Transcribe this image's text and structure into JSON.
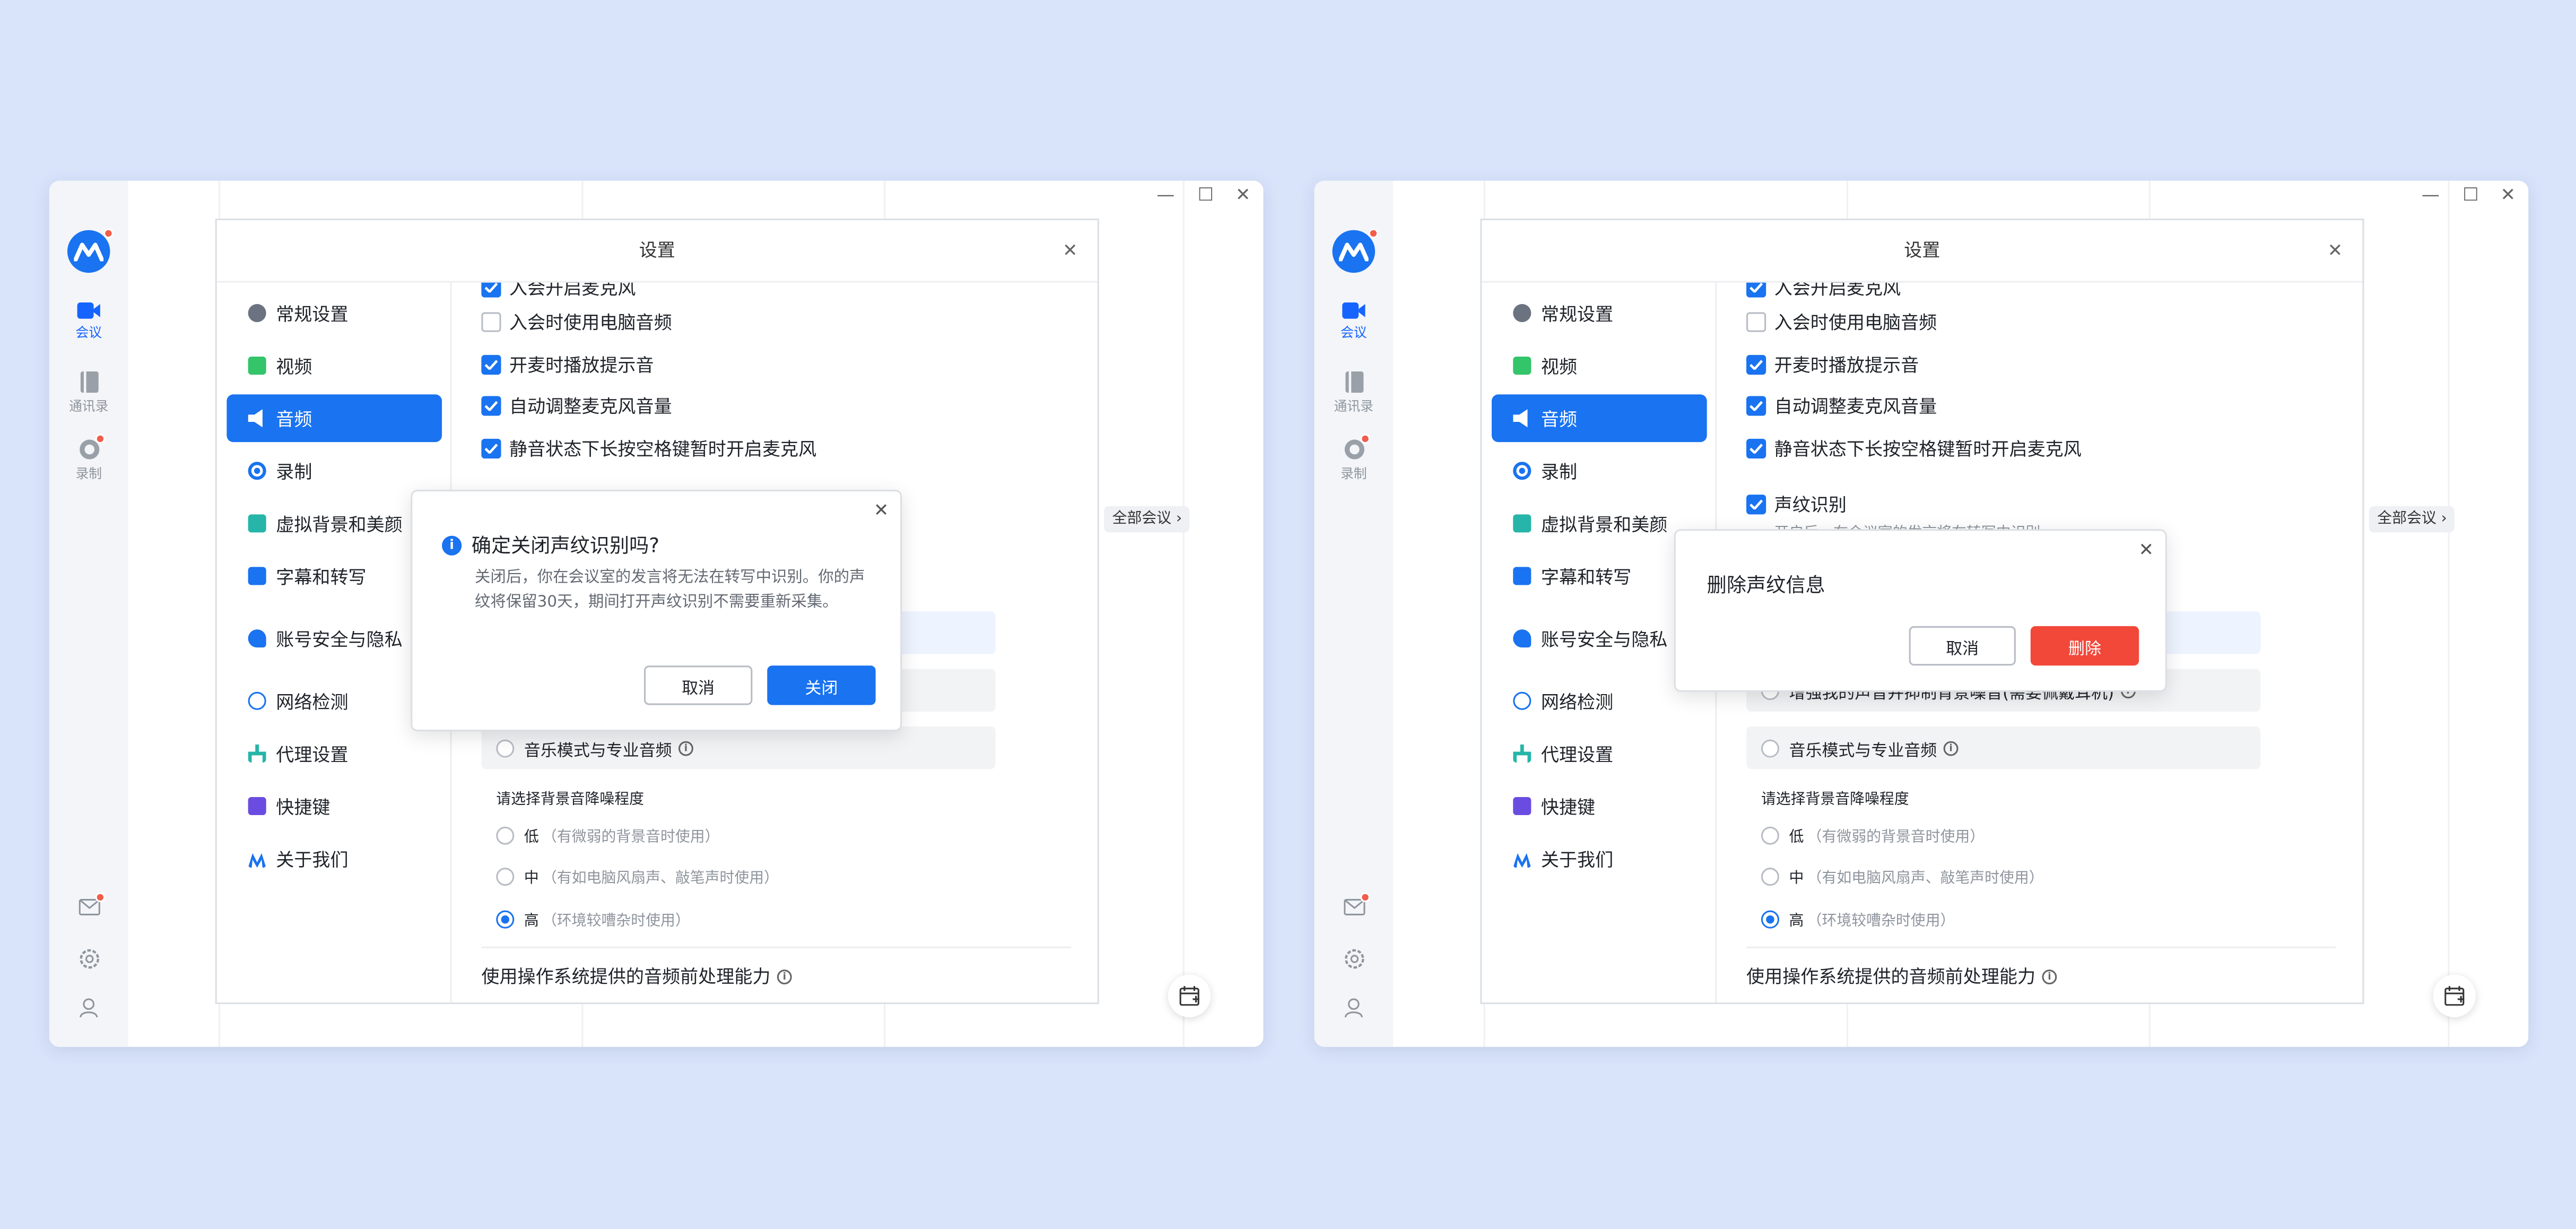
{
  "brand_colors": {
    "primary": "#1a73f0",
    "danger": "#f2483a",
    "background": "#d9e4fb",
    "badge": "#f25c4a"
  },
  "rail": {
    "meeting": "会议",
    "contacts": "通讯录",
    "record": "录制"
  },
  "settings": {
    "title": "设置",
    "nav": [
      "常规设置",
      "视频",
      "音频",
      "录制",
      "虚拟背景和美颜",
      "字幕和转写",
      "账号安全与隐私",
      "网络检测",
      "代理设置",
      "快捷键",
      "关于我们"
    ],
    "nav_active": "音频",
    "nav_icons": [
      "gear-icon",
      "video-icon",
      "speaker-icon",
      "record-icon",
      "portrait-icon",
      "caption-icon",
      "account-shield-icon",
      "globe-icon",
      "proxy-icon",
      "keyboard-icon",
      "logo-icon"
    ]
  },
  "audio": {
    "cut_top": "入会开启麦克风",
    "check_pc_audio": "入会时使用电脑音频",
    "check_tone": "开麦时播放提示音",
    "check_auto_gain": "自动调整麦克风音量",
    "check_space_unmute": "静音状态下长按空格键暂时开启麦克风",
    "check_voiceprint": "声纹识别",
    "voiceprint_cut": "开启后，在会议室的发言将在转写中识别",
    "voice_enhance_cut": "增强我的声音并抑制背景噪音(需要佩戴耳机)",
    "music_mode": "音乐模式与专业音频",
    "noise_title": "请选择背景音降噪程度",
    "noise_low": "低",
    "noise_low_note": "（有微弱的背景音时使用）",
    "noise_mid": "中",
    "noise_mid_note": "（有如电脑风扇声、敲笔声时使用）",
    "noise_high": "高",
    "noise_high_note": "（环境较嘈杂时使用）",
    "os_processing": "使用操作系统提供的音频前处理能力"
  },
  "all_meetings": "全部会议",
  "confirm_close": {
    "title": "确定关闭声纹识别吗?",
    "body": "关闭后，你在会议室的发言将无法在转写中识别。你的声纹将保留30天，期间打开声纹识别不需要重新采集。",
    "cancel": "取消",
    "confirm": "关闭"
  },
  "confirm_delete": {
    "title": "删除声纹信息",
    "cancel": "取消",
    "confirm": "删除"
  }
}
